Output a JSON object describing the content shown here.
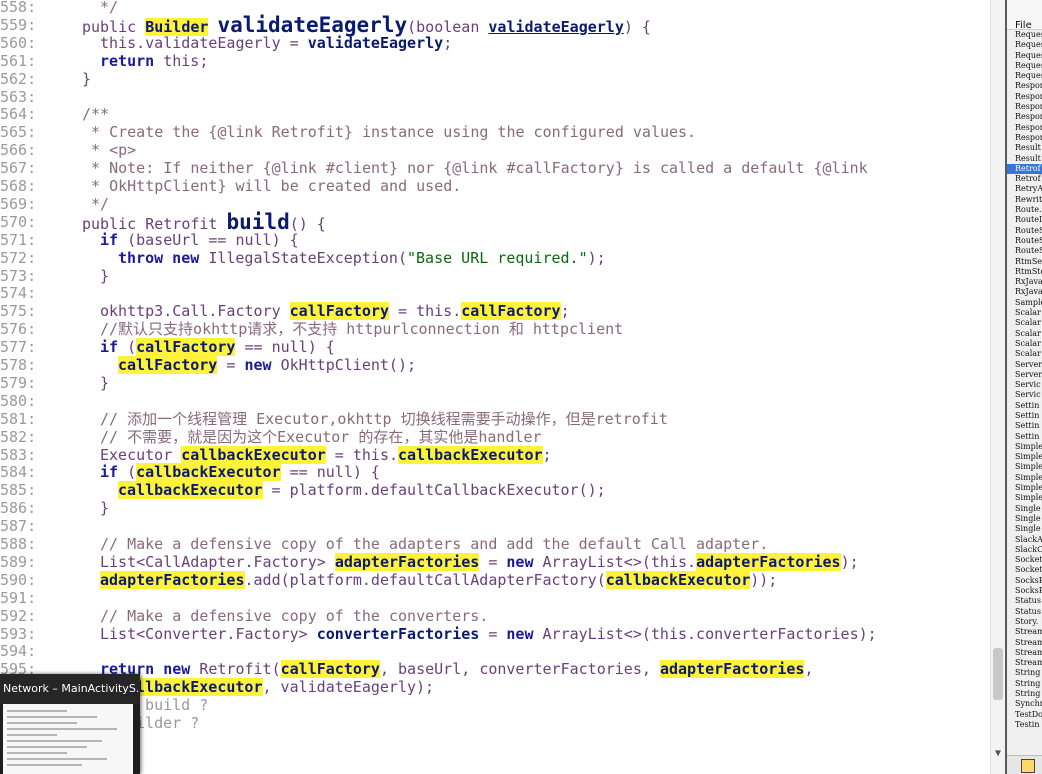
{
  "editor": {
    "lines": [
      {
        "n": "558:",
        "segs": [
          {
            "t": "*/",
            "c": "cm"
          }
        ],
        "indent": 2
      },
      {
        "n": "559:",
        "segs": [
          {
            "t": "public ",
            "c": "ty"
          },
          {
            "t": "Builder",
            "c": "hl"
          },
          {
            "t": " ",
            "c": ""
          },
          {
            "t": "validateEagerly",
            "c": "big"
          },
          {
            "t": "(boolean ",
            "c": "ty"
          },
          {
            "t": "validateEagerly",
            "c": "id und"
          },
          {
            "t": ") {",
            "c": "ty"
          }
        ],
        "indent": 0
      },
      {
        "n": "560:",
        "segs": [
          {
            "t": "this.validateEagerly = ",
            "c": "fd"
          },
          {
            "t": "validateEagerly",
            "c": "id"
          },
          {
            "t": ";",
            "c": "ty"
          }
        ],
        "indent": 2
      },
      {
        "n": "561:",
        "segs": [
          {
            "t": "return ",
            "c": "kw"
          },
          {
            "t": "this;",
            "c": "ty"
          }
        ],
        "indent": 2
      },
      {
        "n": "562:",
        "segs": [
          {
            "t": "}",
            "c": "ty"
          }
        ],
        "indent": 0
      },
      {
        "n": "563:",
        "segs": [],
        "indent": 0
      },
      {
        "n": "564:",
        "segs": [
          {
            "t": "/**",
            "c": "cm"
          }
        ],
        "indent": 0
      },
      {
        "n": "565:",
        "segs": [
          {
            "t": " * Create the {@link Retrofit} instance using the configured values.",
            "c": "cm"
          }
        ],
        "indent": 0
      },
      {
        "n": "566:",
        "segs": [
          {
            "t": " * <p>",
            "c": "cm"
          }
        ],
        "indent": 0
      },
      {
        "n": "567:",
        "segs": [
          {
            "t": " * Note: If neither {@link #client} nor {@link #callFactory} is called a default {@link",
            "c": "cm"
          }
        ],
        "indent": 0
      },
      {
        "n": "568:",
        "segs": [
          {
            "t": " * OkHttpClient} will be created and used.",
            "c": "cm"
          }
        ],
        "indent": 0
      },
      {
        "n": "569:",
        "segs": [
          {
            "t": " */",
            "c": "cm"
          }
        ],
        "indent": 0
      },
      {
        "n": "570:",
        "segs": [
          {
            "t": "public Retrofit ",
            "c": "ty"
          },
          {
            "t": "build",
            "c": "big"
          },
          {
            "t": "() {",
            "c": "ty"
          }
        ],
        "indent": 0
      },
      {
        "n": "571:",
        "segs": [
          {
            "t": "if ",
            "c": "kw"
          },
          {
            "t": "(baseUrl == null) {",
            "c": "ty"
          }
        ],
        "indent": 2
      },
      {
        "n": "572:",
        "segs": [
          {
            "t": "throw new ",
            "c": "kw"
          },
          {
            "t": "IllegalStateException(",
            "c": "ty"
          },
          {
            "t": "\"Base URL required.\"",
            "c": "str"
          },
          {
            "t": ");",
            "c": "ty"
          }
        ],
        "indent": 4
      },
      {
        "n": "573:",
        "segs": [
          {
            "t": "}",
            "c": "ty"
          }
        ],
        "indent": 2
      },
      {
        "n": "574:",
        "segs": [],
        "indent": 0
      },
      {
        "n": "575:",
        "segs": [
          {
            "t": "okhttp3.Call.Factory ",
            "c": "ty"
          },
          {
            "t": "callFactory",
            "c": "hl"
          },
          {
            "t": " = this.",
            "c": "ty"
          },
          {
            "t": "callFactory",
            "c": "hl"
          },
          {
            "t": ";",
            "c": "ty"
          }
        ],
        "indent": 2
      },
      {
        "n": "576:",
        "segs": [
          {
            "t": "//默认只支持okhttp请求，不支持 httpurlconnection 和 httpclient",
            "c": "cm"
          }
        ],
        "indent": 2
      },
      {
        "n": "577:",
        "segs": [
          {
            "t": "if ",
            "c": "kw"
          },
          {
            "t": "(",
            "c": "ty"
          },
          {
            "t": "callFactory",
            "c": "hl"
          },
          {
            "t": " == null) {",
            "c": "ty"
          }
        ],
        "indent": 2
      },
      {
        "n": "578:",
        "segs": [
          {
            "t": "callFactory",
            "c": "hl"
          },
          {
            "t": " = ",
            "c": "ty"
          },
          {
            "t": "new ",
            "c": "kw"
          },
          {
            "t": "OkHttpClient();",
            "c": "ty"
          }
        ],
        "indent": 4
      },
      {
        "n": "579:",
        "segs": [
          {
            "t": "}",
            "c": "ty"
          }
        ],
        "indent": 2
      },
      {
        "n": "580:",
        "segs": [],
        "indent": 0
      },
      {
        "n": "581:",
        "segs": [
          {
            "t": "// 添加一个线程管理 Executor,okhttp 切换线程需要手动操作，但是retrofit",
            "c": "cm"
          }
        ],
        "indent": 2
      },
      {
        "n": "582:",
        "segs": [
          {
            "t": "// 不需要，就是因为这个Executor 的存在，其实他是handler",
            "c": "cm"
          }
        ],
        "indent": 2
      },
      {
        "n": "583:",
        "segs": [
          {
            "t": "Executor ",
            "c": "ty"
          },
          {
            "t": "callbackExecutor",
            "c": "hl"
          },
          {
            "t": " = this.",
            "c": "ty"
          },
          {
            "t": "callbackExecutor",
            "c": "hl"
          },
          {
            "t": ";",
            "c": "ty"
          }
        ],
        "indent": 2
      },
      {
        "n": "584:",
        "segs": [
          {
            "t": "if ",
            "c": "kw"
          },
          {
            "t": "(",
            "c": "ty"
          },
          {
            "t": "callbackExecutor",
            "c": "hl"
          },
          {
            "t": " == null) {",
            "c": "ty"
          }
        ],
        "indent": 2
      },
      {
        "n": "585:",
        "segs": [
          {
            "t": "callbackExecutor",
            "c": "hl"
          },
          {
            "t": " = platform.defaultCallbackExecutor();",
            "c": "ty"
          }
        ],
        "indent": 4
      },
      {
        "n": "586:",
        "segs": [
          {
            "t": "}",
            "c": "ty"
          }
        ],
        "indent": 2
      },
      {
        "n": "587:",
        "segs": [],
        "indent": 0
      },
      {
        "n": "588:",
        "segs": [
          {
            "t": "// Make a defensive copy of the adapters and add the default Call adapter.",
            "c": "cm"
          }
        ],
        "indent": 2
      },
      {
        "n": "589:",
        "segs": [
          {
            "t": "List<CallAdapter.Factory> ",
            "c": "ty"
          },
          {
            "t": "adapterFactories",
            "c": "hl"
          },
          {
            "t": " = ",
            "c": "ty"
          },
          {
            "t": "new ",
            "c": "kw"
          },
          {
            "t": "ArrayList<>(this.",
            "c": "ty"
          },
          {
            "t": "adapterFactories",
            "c": "hl"
          },
          {
            "t": ");",
            "c": "ty"
          }
        ],
        "indent": 2
      },
      {
        "n": "590:",
        "segs": [
          {
            "t": "adapterFactories",
            "c": "hl"
          },
          {
            "t": ".add(platform.defaultCallAdapterFactory(",
            "c": "ty"
          },
          {
            "t": "callbackExecutor",
            "c": "hl"
          },
          {
            "t": "));",
            "c": "ty"
          }
        ],
        "indent": 2
      },
      {
        "n": "591:",
        "segs": [],
        "indent": 0
      },
      {
        "n": "592:",
        "segs": [
          {
            "t": "// Make a defensive copy of the converters.",
            "c": "cm"
          }
        ],
        "indent": 2
      },
      {
        "n": "593:",
        "segs": [
          {
            "t": "List<Converter.Factory> ",
            "c": "ty"
          },
          {
            "t": "converterFactories",
            "c": "id"
          },
          {
            "t": " = ",
            "c": "ty"
          },
          {
            "t": "new ",
            "c": "kw"
          },
          {
            "t": "ArrayList<>(this.converterFactories);",
            "c": "ty"
          }
        ],
        "indent": 2
      },
      {
        "n": "594:",
        "segs": [],
        "indent": 0
      },
      {
        "n": "595:",
        "segs": [
          {
            "t": "return new ",
            "c": "kw"
          },
          {
            "t": "Retrofit(",
            "c": "ty"
          },
          {
            "t": "callFactory",
            "c": "hl"
          },
          {
            "t": ", baseUrl, ",
            "c": "ty"
          },
          {
            "t": "converterFactories",
            "c": "fd"
          },
          {
            "t": ", ",
            "c": "ty"
          },
          {
            "t": "adapterFactories",
            "c": "hl"
          },
          {
            "t": ",",
            "c": "ty"
          }
        ],
        "indent": 2
      },
      {
        "n": "596:",
        "segs": [
          {
            "t": "callbackExecutor",
            "c": "hl"
          },
          {
            "t": ", validateEagerly);",
            "c": "ty"
          }
        ],
        "indent": 4
      },
      {
        "n": "597:",
        "segs": [
          {
            "t": "l build ?",
            "c": "dim"
          }
        ],
        "indent": 5
      },
      {
        "n": "598:",
        "segs": [
          {
            "t": "uilder ?",
            "c": "dim"
          }
        ],
        "indent": 5
      }
    ]
  },
  "file_panel": {
    "header": "File",
    "files": [
      "Request",
      "Request",
      "Request",
      "Request",
      "Request",
      "Respon",
      "Respon",
      "Respon",
      "Respon",
      "Respon",
      "Respon",
      "Result",
      "Result",
      "Retrof",
      "Retrof",
      "RetryA",
      "Rewrit",
      "Route.",
      "RouteD",
      "RouteS",
      "RouteS",
      "RouteS",
      "RtmSes",
      "RtmSto",
      "RxJava",
      "RxJava",
      "Sample",
      "Scalar",
      "Scalar",
      "Scalar",
      "Scalar",
      "Scalar",
      "Server",
      "Server",
      "Servic",
      "Servic",
      "Settin",
      "Settin",
      "Settin",
      "Settin",
      "Simple",
      "Simple",
      "Simple",
      "Simple",
      "Simple",
      "Simple",
      "Single",
      "Single",
      "Single",
      "SlackA",
      "SlackC",
      "Socket",
      "Socket",
      "SocksP",
      "SocksP",
      "Status",
      "Status",
      "Story.",
      "Stream",
      "Stream",
      "Stream",
      "Stream",
      "String",
      "String",
      "String",
      "Synchr",
      "TestDo",
      "Testin"
    ],
    "selected_index": 13
  },
  "thumbnail": {
    "title": "Network – MainActivityS..."
  },
  "colors": {
    "highlight": "#fff23a",
    "keyword": "#1a1a9a",
    "comment": "#8a6a7a",
    "selection": "#3875d7"
  }
}
